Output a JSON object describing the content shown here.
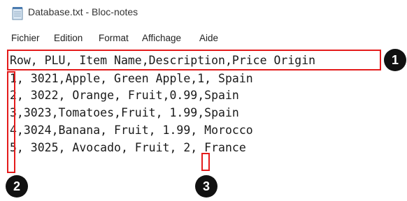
{
  "window": {
    "title": "Database.txt - Bloc-notes",
    "icon": "notepad-icon"
  },
  "menu": {
    "items": [
      "Fichier",
      "Edition",
      "Format",
      "Affichage",
      "Aide"
    ]
  },
  "content": {
    "lines": [
      "Row, PLU, Item Name,Description,Price Origin",
      "1, 3021,Apple, Green Apple,1, Spain",
      "2, 3022, Orange, Fruit,0.99,Spain",
      "3,3023,Tomatoes,Fruit, 1.99,Spain",
      "4,3024,Banana, Fruit, 1.99, Morocco",
      "5, 3025, Avocado, Fruit, 2, France"
    ]
  },
  "annotations": {
    "color": "#e41b1b",
    "badges": [
      "1",
      "2",
      "3"
    ]
  }
}
